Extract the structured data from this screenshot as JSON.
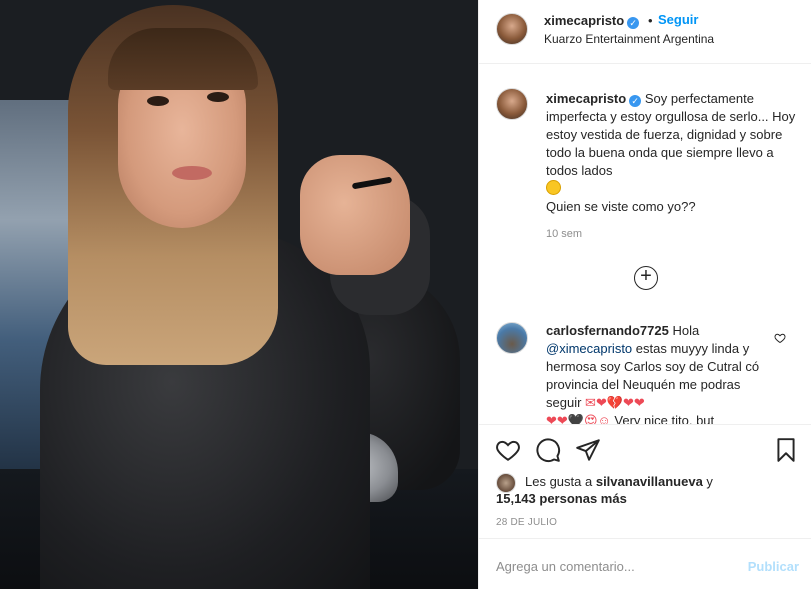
{
  "post": {
    "username": "ximecapristo",
    "verified_mark": "✓",
    "dot": "•",
    "follow_label": "Seguir",
    "location": "Kuarzo Entertainment Argentina"
  },
  "caption": {
    "username": "ximecapristo",
    "line1": "Soy perfectamente imperfecta y estoy orgullosa de serlo... Hoy estoy vestida de fuerza, dignidad y sobre todo la buena onda que siempre llevo a todos lados",
    "line2": "Quien se viste como yo??",
    "time": "10 sem"
  },
  "load_more_symbol": "+",
  "comment": {
    "username": "carlosfernando7725",
    "text_a": "Hola",
    "mention": "@ximecapristo",
    "text_b": "estas muyyy linda y hermosa soy Carlos soy de Cutral có provincia del Neuquén me podras seguir",
    "text_c": "Very nice tito, but"
  },
  "likes": {
    "prefix": "Les gusta a",
    "user": "silvanavillanueva",
    "joiner": "y",
    "count": "15,143 personas más"
  },
  "date": "28 DE JULIO",
  "add_comment": {
    "placeholder": "Agrega un comentario...",
    "publish_label": "Publicar"
  },
  "icons": [
    "heart-icon",
    "comment-icon",
    "share-icon",
    "bookmark-icon",
    "plus-circle-icon"
  ],
  "colors": {
    "link": "#0095f6",
    "verified": "#3897f0",
    "muted": "#8e8e8e",
    "publish_disabled": "#b2dffc"
  }
}
